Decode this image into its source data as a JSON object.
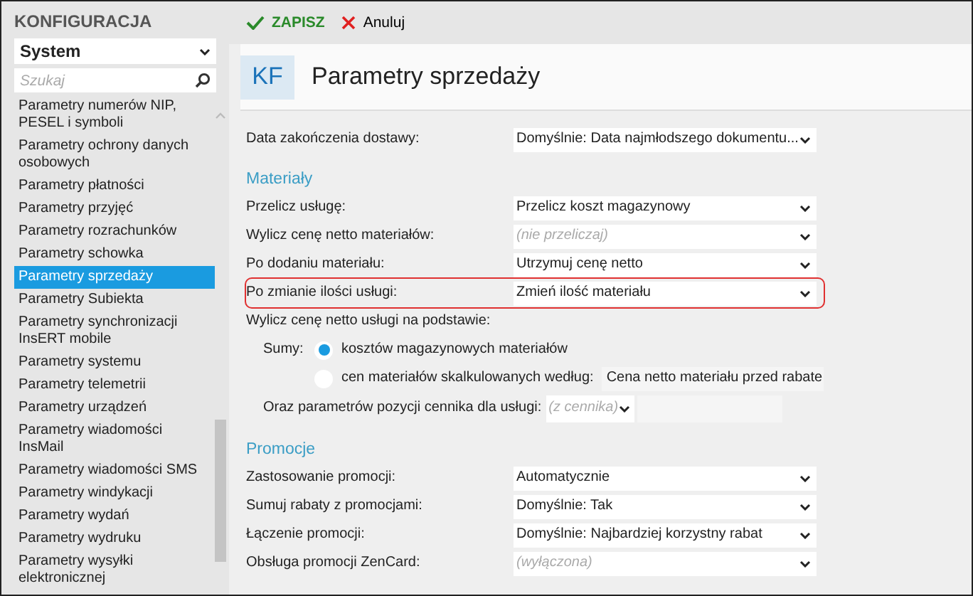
{
  "sidebar": {
    "title": "KONFIGURACJA",
    "category": {
      "value": "System"
    },
    "search": {
      "placeholder": "Szukaj"
    },
    "items": [
      {
        "label": "Parametry numerów NIP, PESEL i symboli",
        "selected": false
      },
      {
        "label": "Parametry ochrony danych osobowych",
        "selected": false
      },
      {
        "label": "Parametry płatności",
        "selected": false
      },
      {
        "label": "Parametry przyjęć",
        "selected": false
      },
      {
        "label": "Parametry rozrachunków",
        "selected": false
      },
      {
        "label": "Parametry schowka",
        "selected": false
      },
      {
        "label": "Parametry sprzedaży",
        "selected": true
      },
      {
        "label": "Parametry Subiekta",
        "selected": false
      },
      {
        "label": "Parametry synchronizacji InsERT mobile",
        "selected": false
      },
      {
        "label": "Parametry systemu",
        "selected": false
      },
      {
        "label": "Parametry telemetrii",
        "selected": false
      },
      {
        "label": "Parametry urządzeń",
        "selected": false
      },
      {
        "label": "Parametry wiadomości InsMail",
        "selected": false
      },
      {
        "label": "Parametry wiadomości SMS",
        "selected": false
      },
      {
        "label": "Parametry windykacji",
        "selected": false
      },
      {
        "label": "Parametry wydań",
        "selected": false
      },
      {
        "label": "Parametry wydruku",
        "selected": false
      },
      {
        "label": "Parametry wysyłki elektronicznej",
        "selected": false
      }
    ]
  },
  "toolbar": [
    {
      "label": "ZAPISZ",
      "kind": "save"
    },
    {
      "label": "Anuluj",
      "kind": "cancel"
    }
  ],
  "header": {
    "badge": "KF",
    "title": "Parametry sprzedaży"
  },
  "sections": [
    {
      "rows": [
        {
          "kind": "select",
          "label": "Data zakończenia dostawy:",
          "value": "Domyślnie: Data najmłodszego dokumentu...",
          "highlighted": false
        }
      ]
    },
    {
      "heading": "Materiały",
      "rows": [
        {
          "kind": "select",
          "label": "Przelicz usługę:",
          "value": "Przelicz koszt magazynowy",
          "highlighted": false
        },
        {
          "kind": "select",
          "label": "Wylicz cenę netto materiałów:",
          "placeholder": "(nie przeliczaj)",
          "highlighted": false
        },
        {
          "kind": "select",
          "label": "Po dodaniu materiału:",
          "value": "Utrzymuj cenę netto",
          "highlighted": false
        },
        {
          "kind": "select",
          "label": "Po zmianie ilości usługi:",
          "value": "Zmień ilość materiału",
          "highlighted": true
        },
        {
          "kind": "text",
          "label": "Wylicz cenę netto usługi na podstawie:"
        },
        {
          "kind": "radio",
          "prefix": "Sumy:",
          "option": "kosztów magazynowych materiałów",
          "selected": true
        },
        {
          "kind": "radio",
          "option": "cen materiałów skalkulowanych według:",
          "selected": false,
          "field": {
            "value": "Cena netto materiału przed rabate"
          }
        },
        {
          "kind": "small_select",
          "label": "Oraz parametrów pozycji cennika dla usługi:",
          "placeholder": "(z cennika)"
        }
      ]
    },
    {
      "heading": "Promocje",
      "rows": [
        {
          "kind": "select",
          "label": "Zastosowanie promocji:",
          "value": "Automatycznie",
          "highlighted": false
        },
        {
          "kind": "select",
          "label": "Sumuj rabaty z promocjami:",
          "value": "Domyślnie: Tak",
          "highlighted": false
        },
        {
          "kind": "select",
          "label": "Łączenie promocji:",
          "value": "Domyślnie: Najbardziej korzystny rabat",
          "highlighted": false
        },
        {
          "kind": "select",
          "label": "Obsługa promocji ZenCard:",
          "placeholder": "(wyłączona)",
          "highlighted": false
        }
      ]
    }
  ]
}
